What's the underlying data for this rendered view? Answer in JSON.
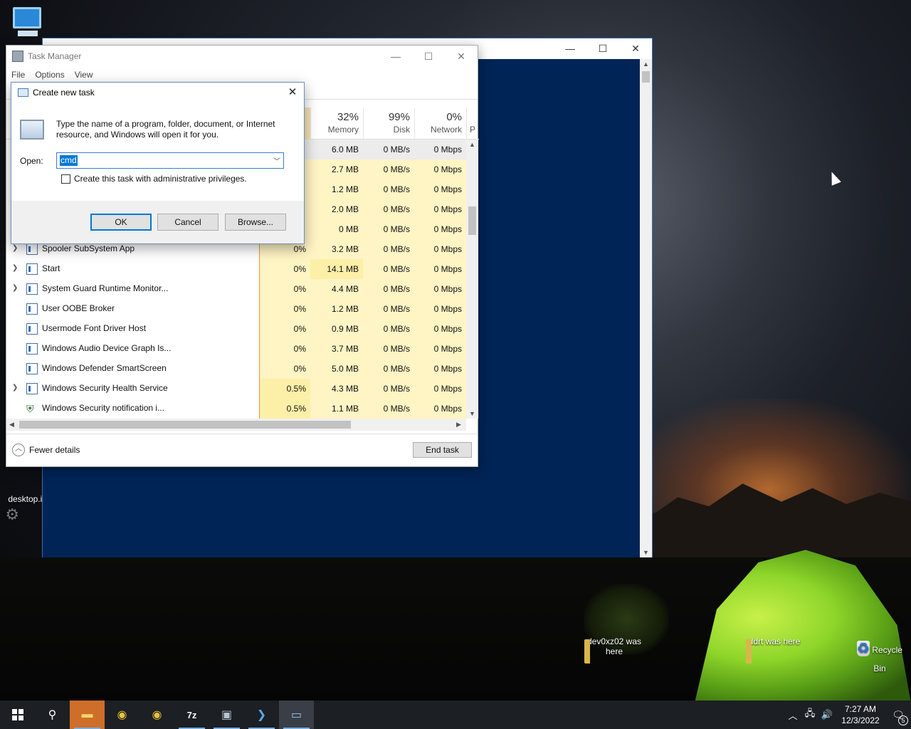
{
  "desktop": {
    "icons": [
      {
        "label": "dev0xz02 was here"
      },
      {
        "label": "ddrt was here"
      },
      {
        "label": "Recycle Bin"
      },
      {
        "label": "desktop.ini"
      }
    ]
  },
  "task_manager": {
    "title": "Task Manager",
    "menu": [
      "File",
      "Options",
      "View"
    ],
    "columns": {
      "memory": {
        "pct": "32%",
        "label": "Memory"
      },
      "disk": {
        "pct": "99%",
        "label": "Disk"
      },
      "network": {
        "pct": "0%",
        "label": "Network"
      },
      "power": {
        "label": "P"
      }
    },
    "rows": [
      {
        "name": "",
        "cpu": "",
        "mem": "6.0 MB",
        "disk": "0 MB/s",
        "net": "0 Mbps"
      },
      {
        "name": "",
        "cpu": "",
        "mem": "2.7 MB",
        "disk": "0 MB/s",
        "net": "0 Mbps"
      },
      {
        "name": "",
        "cpu": "",
        "mem": "1.2 MB",
        "disk": "0 MB/s",
        "net": "0 Mbps"
      },
      {
        "name": "",
        "cpu": "",
        "mem": "2.0 MB",
        "disk": "0 MB/s",
        "net": "0 Mbps"
      },
      {
        "name": "",
        "cpu": "",
        "mem": "0 MB",
        "disk": "0 MB/s",
        "net": "0 Mbps"
      },
      {
        "name": "Spooler SubSystem App",
        "cpu": "0%",
        "mem": "3.2 MB",
        "disk": "0 MB/s",
        "net": "0 Mbps"
      },
      {
        "name": "Start",
        "cpu": "0%",
        "mem": "14.1 MB",
        "disk": "0 MB/s",
        "net": "0 Mbps"
      },
      {
        "name": "System Guard Runtime Monitor...",
        "cpu": "0%",
        "mem": "4.4 MB",
        "disk": "0 MB/s",
        "net": "0 Mbps"
      },
      {
        "name": "User OOBE Broker",
        "cpu": "0%",
        "mem": "1.2 MB",
        "disk": "0 MB/s",
        "net": "0 Mbps"
      },
      {
        "name": "Usermode Font Driver Host",
        "cpu": "0%",
        "mem": "0.9 MB",
        "disk": "0 MB/s",
        "net": "0 Mbps"
      },
      {
        "name": "Windows Audio Device Graph Is...",
        "cpu": "0%",
        "mem": "3.7 MB",
        "disk": "0 MB/s",
        "net": "0 Mbps"
      },
      {
        "name": "Windows Defender SmartScreen",
        "cpu": "0%",
        "mem": "5.0 MB",
        "disk": "0 MB/s",
        "net": "0 Mbps"
      },
      {
        "name": "Windows Security Health Service",
        "cpu": "0.5%",
        "mem": "4.3 MB",
        "disk": "0 MB/s",
        "net": "0 Mbps"
      },
      {
        "name": "Windows Security notification i...",
        "cpu": "0.5%",
        "mem": "1.1 MB",
        "disk": "0 MB/s",
        "net": "0 Mbps"
      }
    ],
    "fewer_details": "Fewer details",
    "end_task": "End task"
  },
  "dialog": {
    "title": "Create new task",
    "description": "Type the name of a program, folder, document, or Internet resource, and Windows will open it for you.",
    "open_label": "Open:",
    "open_value": "cmd",
    "admin_checkbox": "Create this task with administrative privileges.",
    "ok": "OK",
    "cancel": "Cancel",
    "browse": "Browse..."
  },
  "taskbar": {
    "time": "7:27 AM",
    "date": "12/3/2022",
    "notification_count": "5"
  }
}
